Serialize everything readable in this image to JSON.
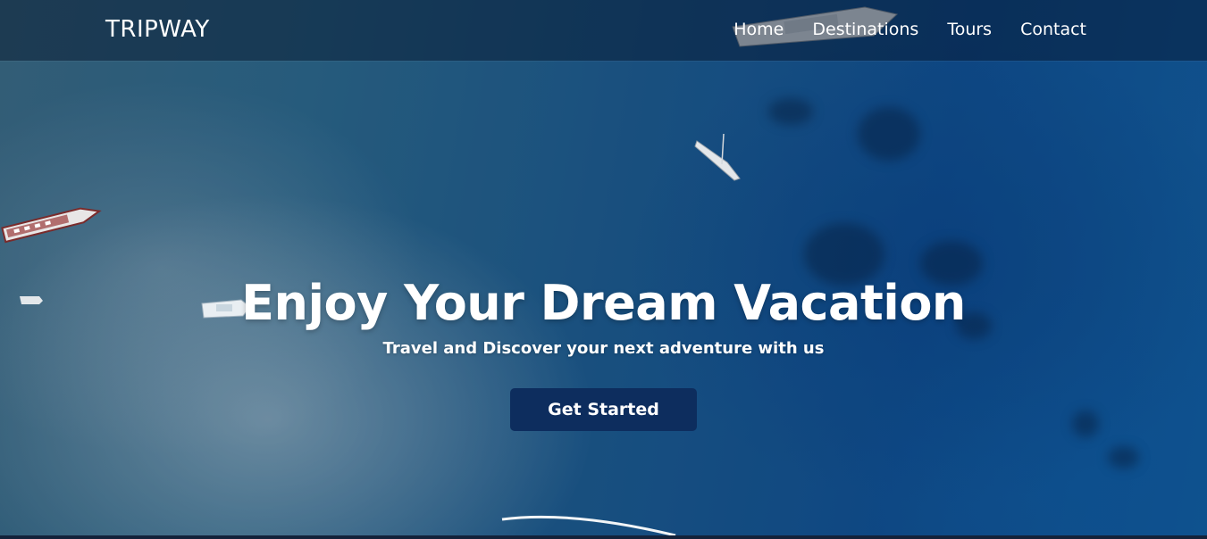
{
  "navbar": {
    "brand": "TRIPWAY",
    "links": [
      {
        "label": "Home"
      },
      {
        "label": "Destinations"
      },
      {
        "label": "Tours"
      },
      {
        "label": "Contact"
      }
    ]
  },
  "hero": {
    "title": "Enjoy Your Dream Vacation",
    "subtitle": "Travel and Discover your next adventure with us",
    "cta_label": "Get Started",
    "background": "aerial-ocean-boats-image"
  },
  "colors": {
    "cta_background": "#0d2d5e",
    "navbar_background": "rgba(4,18,40,0.45)",
    "text": "#ffffff"
  }
}
